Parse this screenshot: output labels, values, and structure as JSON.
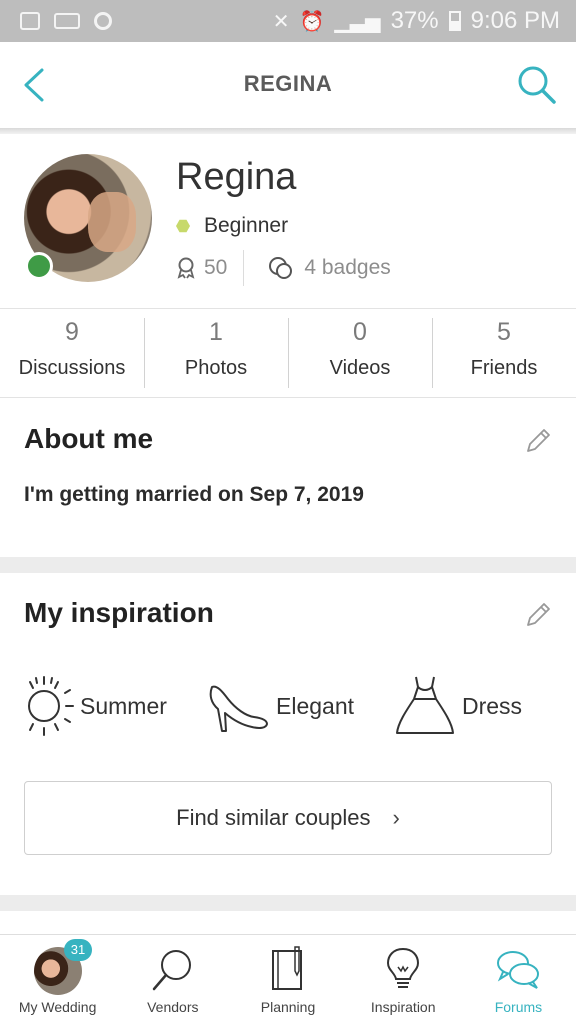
{
  "status_bar": {
    "battery_percent": "37%",
    "time": "9:06 PM"
  },
  "app_bar": {
    "title": "REGINA"
  },
  "profile": {
    "name": "Regina",
    "level": "Beginner",
    "points": "50",
    "badges": "4 badges",
    "online": true
  },
  "counts": [
    {
      "value": "9",
      "label": "Discussions"
    },
    {
      "value": "1",
      "label": "Photos"
    },
    {
      "value": "0",
      "label": "Videos"
    },
    {
      "value": "5",
      "label": "Friends"
    }
  ],
  "about": {
    "title": "About me",
    "text": "I'm getting married on Sep 7, 2019"
  },
  "inspiration": {
    "title": "My inspiration",
    "items": [
      {
        "label": "Summer",
        "icon": "sun-icon"
      },
      {
        "label": "Elegant",
        "icon": "high-heel-icon"
      },
      {
        "label": "Dress",
        "icon": "dress-icon"
      }
    ],
    "button": "Find similar couples"
  },
  "bottom_nav": {
    "items": [
      {
        "label": "My Wedding",
        "badge": "31"
      },
      {
        "label": "Vendors"
      },
      {
        "label": "Planning"
      },
      {
        "label": "Inspiration"
      },
      {
        "label": "Forums",
        "active": true
      }
    ]
  },
  "colors": {
    "accent": "#37b3c0",
    "online": "#3f9b46",
    "level": "#c7d96b"
  }
}
